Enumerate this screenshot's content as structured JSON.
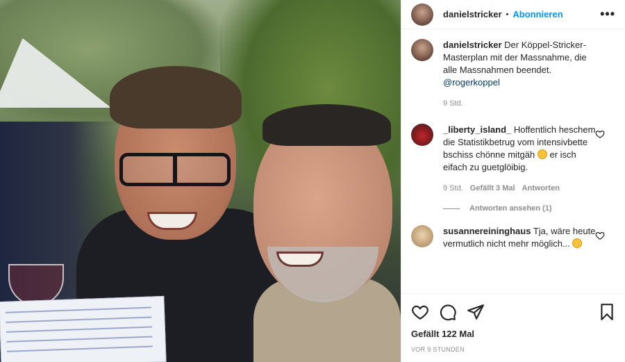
{
  "post": {
    "username": "danielstricker",
    "separator": "•",
    "follow_label": "Abonnieren",
    "more_label": "•••"
  },
  "caption": {
    "username": "danielstricker",
    "text": "Der Köppel-Stricker-Masterplan mit der Massnahme, die alle Massnahmen beendet.",
    "mention": "@rogerkoppel",
    "time": "9 Std."
  },
  "comments": [
    {
      "username": "_liberty_island_",
      "text": "Hoffentlich heschem die Statistikbetrug vom intensivbette bschiss chönne mitgäh",
      "text_after_emoji": "er isch eifach zu guetglöibig.",
      "time": "9 Std.",
      "likes": "Gefällt 3 Mal",
      "reply_label": "Antworten",
      "view_replies": "Antworten ansehen (1)"
    },
    {
      "username": "susannereininghaus",
      "text": "Tja, wäre heute vermutlich nicht mehr möglich..."
    }
  ],
  "footer": {
    "likes": "Gefällt 122 Mal",
    "timestamp": "VOR 9 STUNDEN"
  },
  "icons": [
    "heart-icon",
    "comment-icon",
    "share-icon",
    "bookmark-icon",
    "more-icon",
    "emoji-icon"
  ],
  "colors": {
    "link": "#0095f6",
    "muted": "#8e8e8e",
    "text": "#262626",
    "mention": "#00376b"
  }
}
